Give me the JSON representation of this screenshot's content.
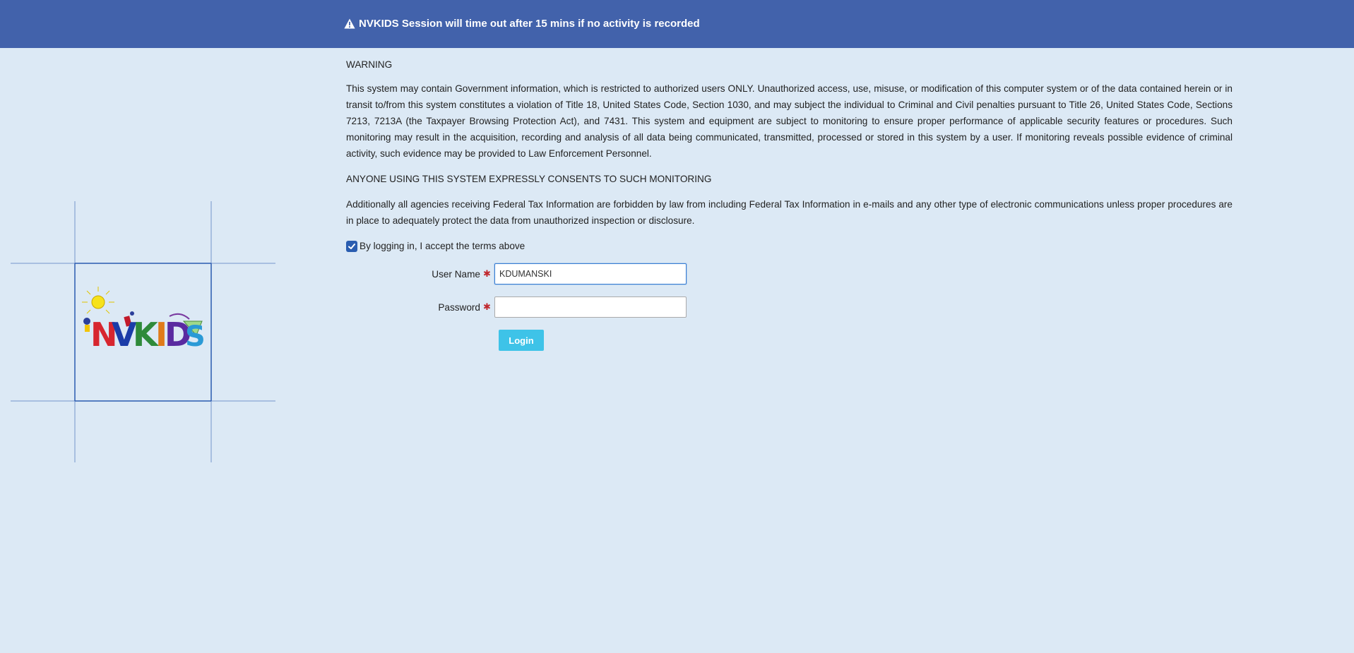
{
  "banner": {
    "text": "NVKIDS Session will time out after 15 mins if no activity is recorded",
    "icon": "warning-triangle-icon",
    "background": "#4262ab"
  },
  "logo": {
    "text": "NVKIDS"
  },
  "notice": {
    "heading": "WARNING",
    "paragraph1": "This system may contain Government information, which is restricted to authorized users ONLY. Unauthorized access, use, misuse, or modification of this computer system or of the data contained herein or in transit to/from this system constitutes a violation of Title 18, United States Code, Section 1030, and may subject the individual to Criminal and Civil penalties pursuant to Title 26, United States Code, Sections 7213, 7213A (the Taxpayer Browsing Protection Act), and 7431. This system and equipment are subject to monitoring to ensure proper performance of applicable security features or procedures. Such monitoring may result in the acquisition, recording and analysis of all data being communicated, transmitted, processed or stored in this system by a user. If monitoring reveals possible evidence of criminal activity, such evidence may be provided to Law Enforcement Personnel.",
    "consent": "ANYONE USING THIS SYSTEM EXPRESSLY CONSENTS TO SUCH MONITORING",
    "paragraph2": "Additionally all agencies receiving Federal Tax Information are forbidden by law from including Federal Tax Information in e-mails and any other type of electronic communications unless proper procedures are in place to adequately protect the data from unauthorized inspection or disclosure."
  },
  "accept": {
    "label": "By logging in, I accept the terms above",
    "checked": true
  },
  "form": {
    "username_label": "User Name",
    "username_value": "KDUMANSKI",
    "password_label": "Password",
    "password_value": "",
    "required_marker": "✱",
    "login_label": "Login"
  },
  "colors": {
    "page_bg": "#dce9f5",
    "login_button": "#3ec3e8",
    "required": "#c0272d"
  }
}
